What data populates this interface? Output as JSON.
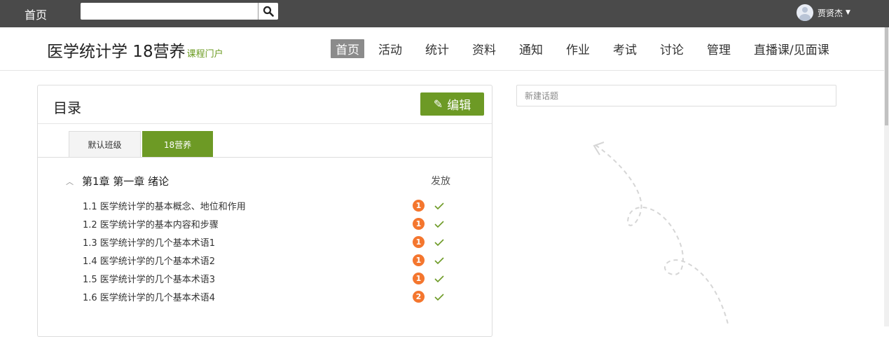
{
  "topbar": {
    "home_label": "首页",
    "search_placeholder": "",
    "search_icon": "search-icon",
    "user_name": "贾贤杰",
    "user_caret": "chevron-down-icon"
  },
  "header": {
    "course_title": "医学统计学 18营养",
    "course_subtitle": "课程门户",
    "nav": [
      {
        "label": "首页",
        "active": true
      },
      {
        "label": "活动"
      },
      {
        "label": "统计"
      },
      {
        "label": "资料"
      },
      {
        "label": "通知"
      },
      {
        "label": "作业"
      },
      {
        "label": "考试"
      },
      {
        "label": "讨论"
      },
      {
        "label": "管理"
      },
      {
        "label": "直播课/见面课"
      }
    ]
  },
  "catalog": {
    "title": "目录",
    "edit_label": "编辑",
    "tabs": [
      "默认班级",
      "18营养"
    ],
    "release_label": "发放",
    "chapter": "第1章 第一章 绪论",
    "sections": [
      {
        "label": "1.1  医学统计学的基本概念、地位和作用",
        "badge": "1"
      },
      {
        "label": "1.2  医学统计学的基本内容和步骤",
        "badge": "1"
      },
      {
        "label": "1.3  医学统计学的几个基本术语1",
        "badge": "1"
      },
      {
        "label": "1.4  医学统计学的几个基本术语2",
        "badge": "1"
      },
      {
        "label": "1.5  医学统计学的几个基本术语3",
        "badge": "1"
      },
      {
        "label": "1.6  医学统计学的几个基本术语4",
        "badge": "2"
      }
    ]
  },
  "discussion": {
    "new_topic_placeholder": "新建话题"
  },
  "colors": {
    "topbar_bg": "#4a4a4a",
    "accent_green": "#6d9a25",
    "badge_orange": "#f4762e"
  }
}
